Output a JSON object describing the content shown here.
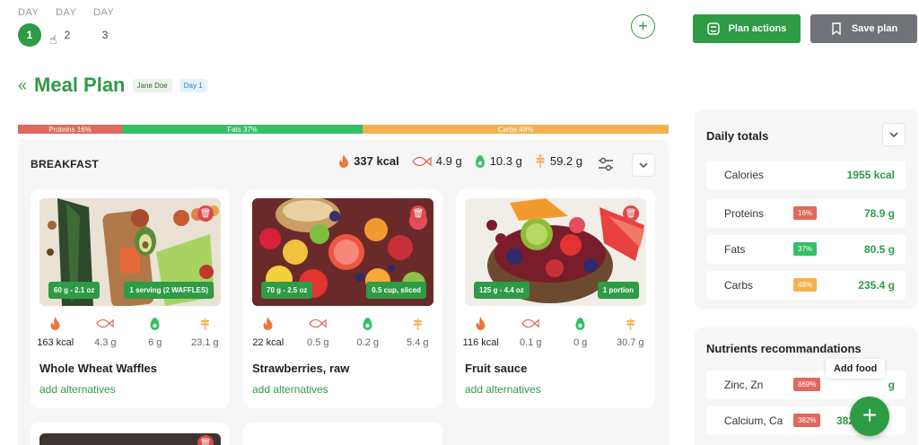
{
  "days": {
    "label": "DAY",
    "items": [
      {
        "number": "1",
        "active": true
      },
      {
        "number": "2",
        "active": false
      },
      {
        "number": "3",
        "active": false
      }
    ]
  },
  "header": {
    "add_day_label": "+",
    "plan_actions_label": "Plan actions",
    "save_plan_label": "Save plan"
  },
  "page": {
    "title": "Meal Plan",
    "user_tag": "Jane Doe",
    "day_tag": "Day 1"
  },
  "macro_bar": {
    "proteins": "Proteins 16%",
    "fats": "Fats 37%",
    "carbs": "Carbs 48%"
  },
  "breakfast": {
    "title": "BREAKFAST",
    "kcal": "337 kcal",
    "protein": "4.9 g",
    "fat": "10.3 g",
    "carbs": "59.2 g",
    "foods": [
      {
        "name": "Whole Wheat Waffles",
        "qty1": "60 g - 2.1 oz",
        "qty2": "1 serving (2 WAFFLES)",
        "kcal": "163 kcal",
        "protein": "4.3 g",
        "fat": "6 g",
        "carbs": "23.1 g",
        "alt": "add alternatives"
      },
      {
        "name": "Strawberries, raw",
        "qty1": "70 g - 2.5 oz",
        "qty2": "0.5 cup, sliced",
        "kcal": "22 kcal",
        "protein": "0.5 g",
        "fat": "0.2 g",
        "carbs": "5.4 g",
        "alt": "add alternatives"
      },
      {
        "name": "Fruit sauce",
        "qty1": "125 g - 4.4 oz",
        "qty2": "1 portion",
        "kcal": "116 kcal",
        "protein": "0.1 g",
        "fat": "0 g",
        "carbs": "30.7 g",
        "alt": "add alternatives"
      }
    ]
  },
  "daily_totals": {
    "title": "Daily totals",
    "rows": [
      {
        "label": "Calories",
        "pct": "",
        "value": "1955 kcal"
      },
      {
        "label": "Proteins",
        "pct": "16%",
        "value": "78.9 g"
      },
      {
        "label": "Fats",
        "pct": "37%",
        "value": "80.5 g"
      },
      {
        "label": "Carbs",
        "pct": "48%",
        "value": "235.4 g"
      }
    ]
  },
  "nutrients": {
    "title": "Nutrients recommandations",
    "rows": [
      {
        "label": "Zinc, Zn",
        "pct": "869%",
        "value": "g"
      },
      {
        "label": "Calcium, Ca",
        "pct": "382%",
        "value": "382"
      }
    ]
  },
  "fab": {
    "tooltip": "Add food",
    "icon": "+"
  },
  "colors": {
    "accent": "#2e9b45",
    "protein": "#e0685c",
    "fat": "#34bf67",
    "carbs": "#f5b04f",
    "secondary_button": "#6f7378"
  }
}
